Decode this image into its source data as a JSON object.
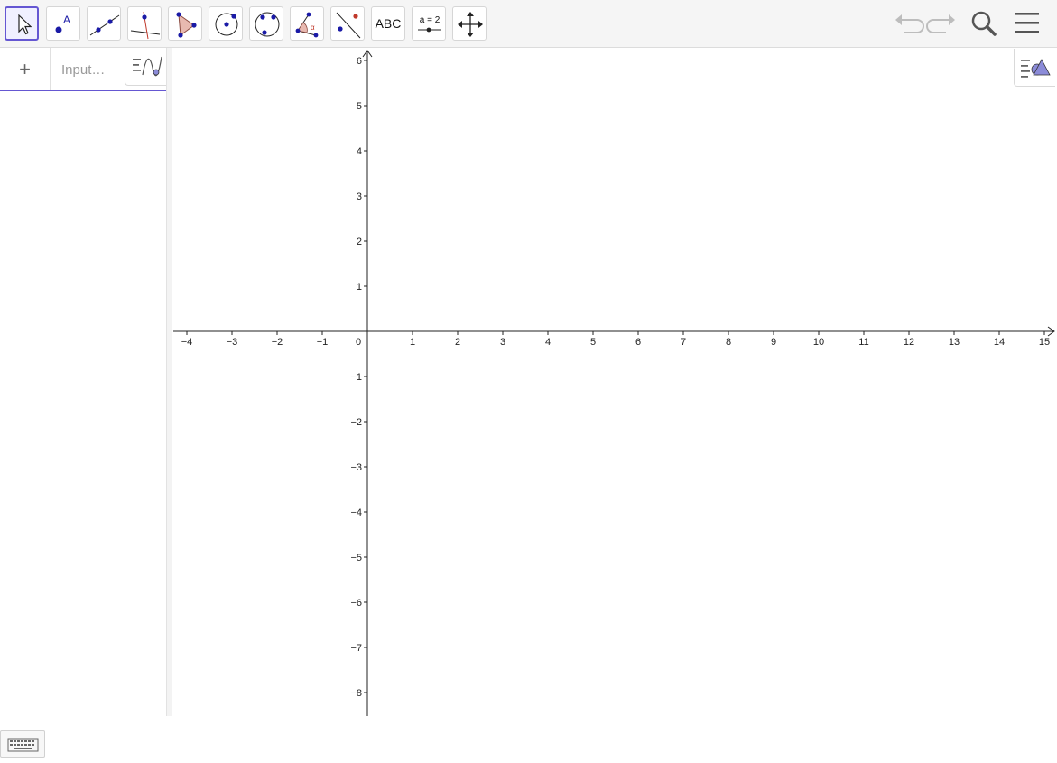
{
  "toolbar": {
    "tools": [
      {
        "name": "move-tool",
        "icon": "arrow-cursor-icon",
        "selected": true
      },
      {
        "name": "point-tool",
        "icon": "point-icon",
        "label": "A"
      },
      {
        "name": "line-tool",
        "icon": "line-icon"
      },
      {
        "name": "perpendicular-line-tool",
        "icon": "perpendicular-icon"
      },
      {
        "name": "polygon-tool",
        "icon": "polygon-icon"
      },
      {
        "name": "circle-tool",
        "icon": "circle-center-icon"
      },
      {
        "name": "conic-tool",
        "icon": "ellipse-icon"
      },
      {
        "name": "angle-tool",
        "icon": "angle-icon"
      },
      {
        "name": "reflect-tool",
        "icon": "reflect-icon"
      },
      {
        "name": "text-tool",
        "icon": "text-icon",
        "label": "ABC"
      },
      {
        "name": "slider-tool",
        "icon": "slider-icon",
        "label": "a = 2"
      },
      {
        "name": "move-graphics-tool",
        "icon": "move-arrows-icon"
      }
    ],
    "undo_icon": "undo-icon",
    "redo_icon": "redo-icon",
    "search_icon": "search-icon",
    "menu_icon": "hamburger-menu-icon"
  },
  "algebra": {
    "add_label": "+",
    "input_placeholder": "Input…"
  },
  "graphics": {
    "x_ticks": [
      "−4",
      "−3",
      "−2",
      "−1",
      "0",
      "1",
      "2",
      "3",
      "4",
      "5",
      "6",
      "7",
      "8",
      "9",
      "10",
      "11",
      "12",
      "13",
      "14",
      "15"
    ],
    "y_ticks_positive": [
      "1",
      "2",
      "3",
      "4",
      "5",
      "6"
    ],
    "y_ticks_negative": [
      "−1",
      "−2",
      "−3",
      "−4",
      "−5",
      "−6",
      "−7",
      "−8"
    ]
  },
  "colors": {
    "accent": "#6557d2",
    "point": "#1a1aa6",
    "polygon_fill": "#e8b9b0"
  }
}
